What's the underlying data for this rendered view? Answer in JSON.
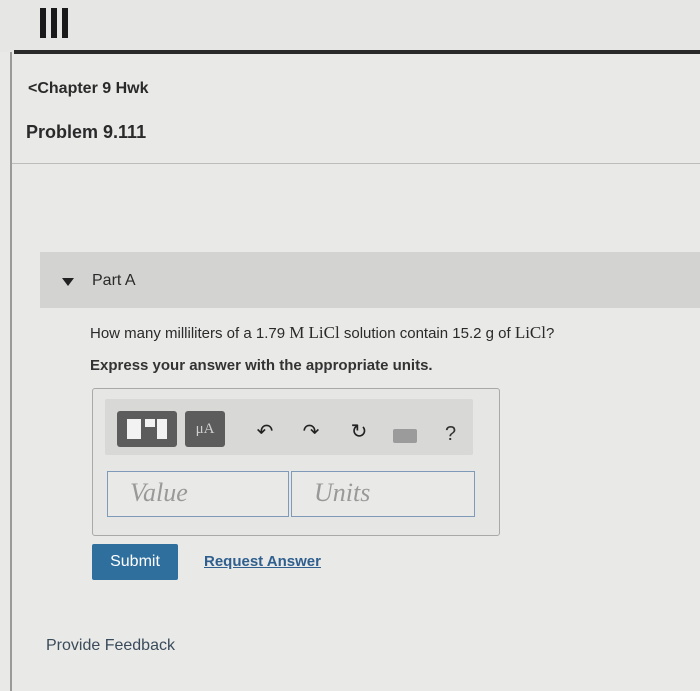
{
  "header": {
    "chapter_link": "Chapter 9 Hwk",
    "problem_title": "Problem 9.111"
  },
  "part": {
    "label": "Part A",
    "question_prefix": "How many milliliters of a 1.79 ",
    "question_molarity_unit": "M",
    "question_solute": "LiCl",
    "question_middle": " solution contain 15.2 g of ",
    "question_solute_end": "LiCl",
    "question_suffix": "?",
    "instruction": "Express your answer with the appropriate units."
  },
  "toolbar": {
    "mu_label": "μA",
    "undo_icon": "undo-icon",
    "redo_icon": "redo-icon",
    "reset_icon": "reset-icon",
    "keyboard_icon": "keyboard-icon",
    "help_label": "?"
  },
  "answer": {
    "value_placeholder": "Value",
    "units_placeholder": "Units"
  },
  "actions": {
    "submit_label": "Submit",
    "request_answer_label": "Request Answer"
  },
  "footer": {
    "feedback_label": "Provide Feedback"
  },
  "colors": {
    "submit_bg": "#2f6f9e",
    "link": "#2f5f8e",
    "input_border": "#7f9ab8"
  }
}
